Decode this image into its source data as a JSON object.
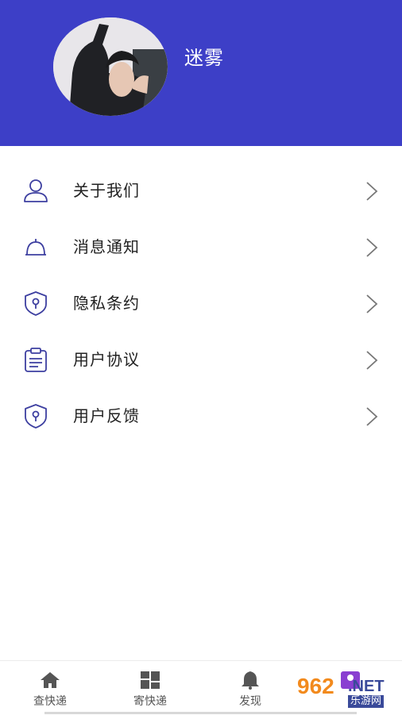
{
  "profile": {
    "username": "迷雾"
  },
  "menu": {
    "items": [
      {
        "label": "关于我们",
        "icon": "user-icon"
      },
      {
        "label": "消息通知",
        "icon": "bell-icon"
      },
      {
        "label": "隐私条约",
        "icon": "shield-icon"
      },
      {
        "label": "用户协议",
        "icon": "clipboard-icon"
      },
      {
        "label": "用户反馈",
        "icon": "shield-icon"
      }
    ]
  },
  "tabs": [
    {
      "label": "查快递",
      "icon": "home-icon"
    },
    {
      "label": "寄快递",
      "icon": "grid-icon"
    },
    {
      "label": "发现",
      "icon": "bell-icon"
    },
    {
      "label": "",
      "icon": "profile-icon"
    }
  ],
  "watermark": {
    "brand": "962",
    "suffix": ".NET",
    "sub": "乐游网"
  },
  "colors": {
    "header": "#3d3fc7",
    "icon_stroke": "#3d3fa0",
    "active_tab": "#8a3fd1"
  }
}
